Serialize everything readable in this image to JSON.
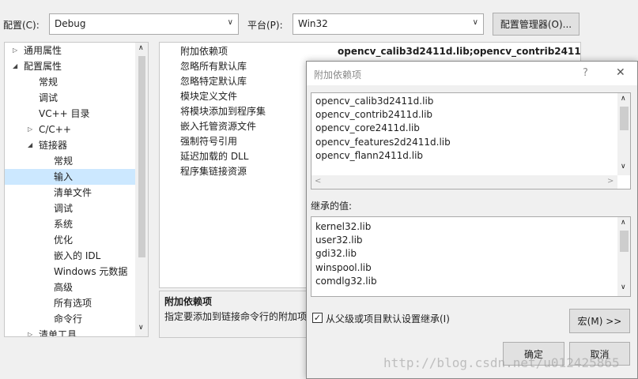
{
  "toolbar": {
    "config_label": "配置(C):",
    "config_value": "Debug",
    "platform_label": "平台(P):",
    "platform_value": "Win32",
    "config_manager_label": "配置管理器(O)..."
  },
  "tree": {
    "items": [
      {
        "label": "通用属性",
        "expander": "▷",
        "level": 0
      },
      {
        "label": "配置属性",
        "expander": "◢",
        "level": 0
      },
      {
        "label": "常规",
        "expander": "",
        "level": 1
      },
      {
        "label": "调试",
        "expander": "",
        "level": 1
      },
      {
        "label": "VC++ 目录",
        "expander": "",
        "level": 1
      },
      {
        "label": "C/C++",
        "expander": "▷",
        "level": 1
      },
      {
        "label": "链接器",
        "expander": "◢",
        "level": 1
      },
      {
        "label": "常规",
        "expander": "",
        "level": 2
      },
      {
        "label": "输入",
        "expander": "",
        "level": 2,
        "selected": true
      },
      {
        "label": "清单文件",
        "expander": "",
        "level": 2
      },
      {
        "label": "调试",
        "expander": "",
        "level": 2
      },
      {
        "label": "系统",
        "expander": "",
        "level": 2
      },
      {
        "label": "优化",
        "expander": "",
        "level": 2
      },
      {
        "label": "嵌入的 IDL",
        "expander": "",
        "level": 2
      },
      {
        "label": "Windows 元数据",
        "expander": "",
        "level": 2
      },
      {
        "label": "高级",
        "expander": "",
        "level": 2
      },
      {
        "label": "所有选项",
        "expander": "",
        "level": 2
      },
      {
        "label": "命令行",
        "expander": "",
        "level": 2
      },
      {
        "label": "清单工具",
        "expander": "▷",
        "level": 1
      }
    ]
  },
  "properties": {
    "first_value": "opencv_calib3d2411d.lib;opencv_contrib2411d.lib;o",
    "names": [
      "附加依赖项",
      "忽略所有默认库",
      "忽略特定默认库",
      "模块定义文件",
      "将模块添加到程序集",
      "嵌入托管资源文件",
      "强制符号引用",
      "延迟加载的 DLL",
      "程序集链接资源"
    ]
  },
  "description": {
    "title": "附加依赖项",
    "text": "指定要添加到链接命令行的附加项"
  },
  "dialog": {
    "title": "附加依赖项",
    "help_glyph": "?",
    "close_glyph": "✕",
    "libs": [
      "opencv_calib3d2411d.lib",
      "opencv_contrib2411d.lib",
      "opencv_core2411d.lib",
      "opencv_features2d2411d.lib",
      "opencv_flann2411d.lib"
    ],
    "inherited_label": "继承的值:",
    "inherited": [
      "kernel32.lib",
      "user32.lib",
      "gdi32.lib",
      "winspool.lib",
      "comdlg32.lib"
    ],
    "inherit_checkbox_label": "从父级或项目默认设置继承(I)",
    "inherit_checked": true,
    "macro_button": "宏(M) >>",
    "ok_button": "确定",
    "cancel_button": "取消"
  },
  "watermark": "http://blog.csdn.net/u012425865",
  "colors": {
    "selection": "#cce8ff",
    "window": "#f0f0f0"
  }
}
